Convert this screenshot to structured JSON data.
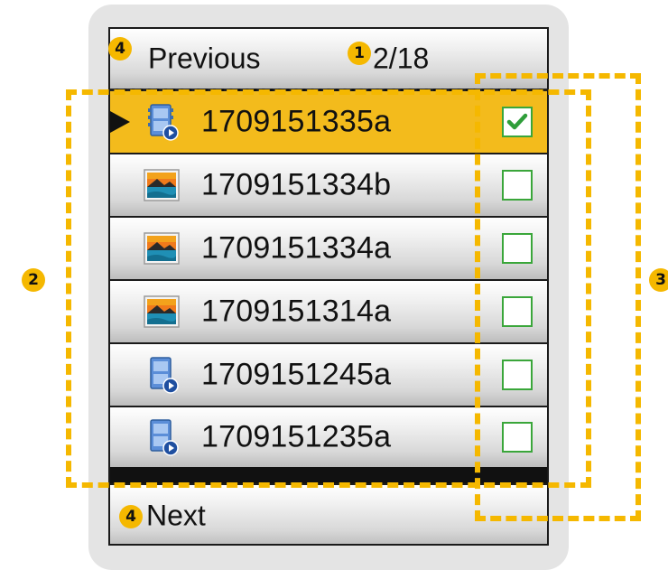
{
  "header": {
    "previous_label": "Previous",
    "page_indicator": "2/18",
    "previous_callout": "4",
    "page_callout": "1"
  },
  "files": [
    {
      "name": "1709151335a",
      "type": "video",
      "icon": "video-file-icon",
      "selected": true,
      "checked": true
    },
    {
      "name": "1709151334b",
      "type": "image",
      "icon": "image-file-icon",
      "selected": false,
      "checked": false
    },
    {
      "name": "1709151334a",
      "type": "image",
      "icon": "image-file-icon",
      "selected": false,
      "checked": false
    },
    {
      "name": "1709151314a",
      "type": "image",
      "icon": "image-file-icon",
      "selected": false,
      "checked": false
    },
    {
      "name": "1709151245a",
      "type": "video",
      "icon": "video-file-icon",
      "selected": false,
      "checked": false
    },
    {
      "name": "1709151235a",
      "type": "video",
      "icon": "video-file-icon",
      "selected": false,
      "checked": false
    }
  ],
  "footer": {
    "next_label": "Next",
    "next_callout": "4"
  },
  "callouts": {
    "file_list": "2",
    "checkbox_column": "3"
  },
  "colors": {
    "selection": "#f3bb1c",
    "callout": "#f5b800",
    "checkbox_border": "#3aa63a",
    "device_bezel": "#e4e4e4"
  }
}
